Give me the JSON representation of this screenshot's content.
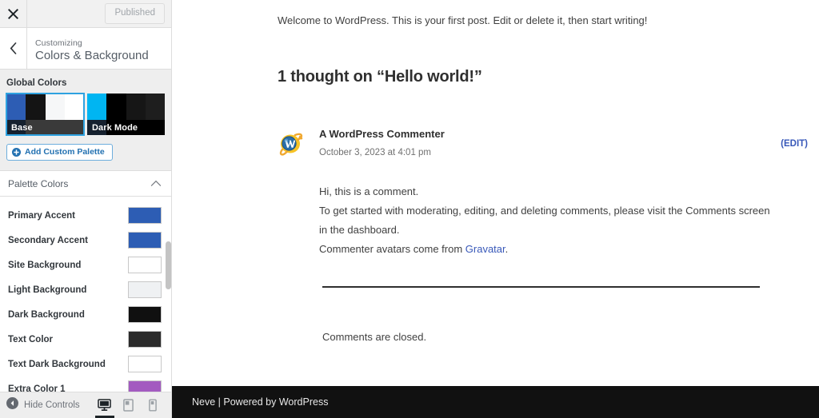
{
  "customizer": {
    "topbar": {
      "close_icon": "close-x-icon",
      "published_label": "Published"
    },
    "header": {
      "back_icon": "chevron-left-icon",
      "eyebrow": "Customizing",
      "title": "Colors & Background"
    },
    "global_colors": {
      "label": "Global Colors",
      "palettes": [
        {
          "name": "Base",
          "selected": true,
          "top_swatches": [
            "#2d5db4",
            "#141414",
            "#f6f7f8",
            "#ffffff"
          ],
          "bottom_swatches": [
            "#16212f",
            "#3a3a3a",
            "#3a3a3a",
            "#3a3a3a"
          ]
        },
        {
          "name": "Dark Mode",
          "selected": false,
          "top_swatches": [
            "#00b5f2",
            "#000000",
            "#161616",
            "#1e1e1e"
          ],
          "bottom_swatches": [
            "#16212f",
            "#000000",
            "#000000",
            "#000000"
          ]
        }
      ],
      "add_palette_label": "Add Custom Palette",
      "add_palette_icon": "plus-circle-icon"
    },
    "palette_section": {
      "title": "Palette Colors",
      "collapse_icon": "chevron-up-icon",
      "colors": [
        {
          "label": "Primary Accent",
          "value": "#2d5db4"
        },
        {
          "label": "Secondary Accent",
          "value": "#2d5db4"
        },
        {
          "label": "Site Background",
          "value": "#ffffff"
        },
        {
          "label": "Light Background",
          "value": "#eff1f3"
        },
        {
          "label": "Dark Background",
          "value": "#101010"
        },
        {
          "label": "Text Color",
          "value": "#2b2b2b"
        },
        {
          "label": "Text Dark Background",
          "value": "#ffffff"
        },
        {
          "label": "Extra Color 1",
          "value": "#a35bc0"
        }
      ]
    },
    "footer": {
      "hide_controls_label": "Hide Controls",
      "hide_controls_icon": "collapse-left-icon",
      "devices": [
        {
          "name": "desktop",
          "icon": "desktop-icon",
          "active": true
        },
        {
          "name": "tablet",
          "icon": "tablet-icon",
          "active": false
        },
        {
          "name": "mobile",
          "icon": "mobile-icon",
          "active": false
        }
      ]
    }
  },
  "preview": {
    "post_intro": "Welcome to WordPress. This is your first post. Edit or delete it, then start writing!",
    "comments_title": "1 thought on “Hello world!”",
    "comment": {
      "avatar_icon": "wordpress-avatar-icon",
      "author": "A WordPress Commenter",
      "date": "October 3, 2023 at 4:01 pm",
      "edit_label": "(EDIT)",
      "line1": "Hi, this is a comment.",
      "line2": "To get started with moderating, editing, and deleting comments, please visit the Comments screen",
      "line3": "in the dashboard.",
      "line4_prefix": "Commenter avatars come from ",
      "line4_link": "Gravatar",
      "line4_suffix": "."
    },
    "comments_closed": "Comments are closed.",
    "site_footer": "Neve | Powered by WordPress"
  }
}
